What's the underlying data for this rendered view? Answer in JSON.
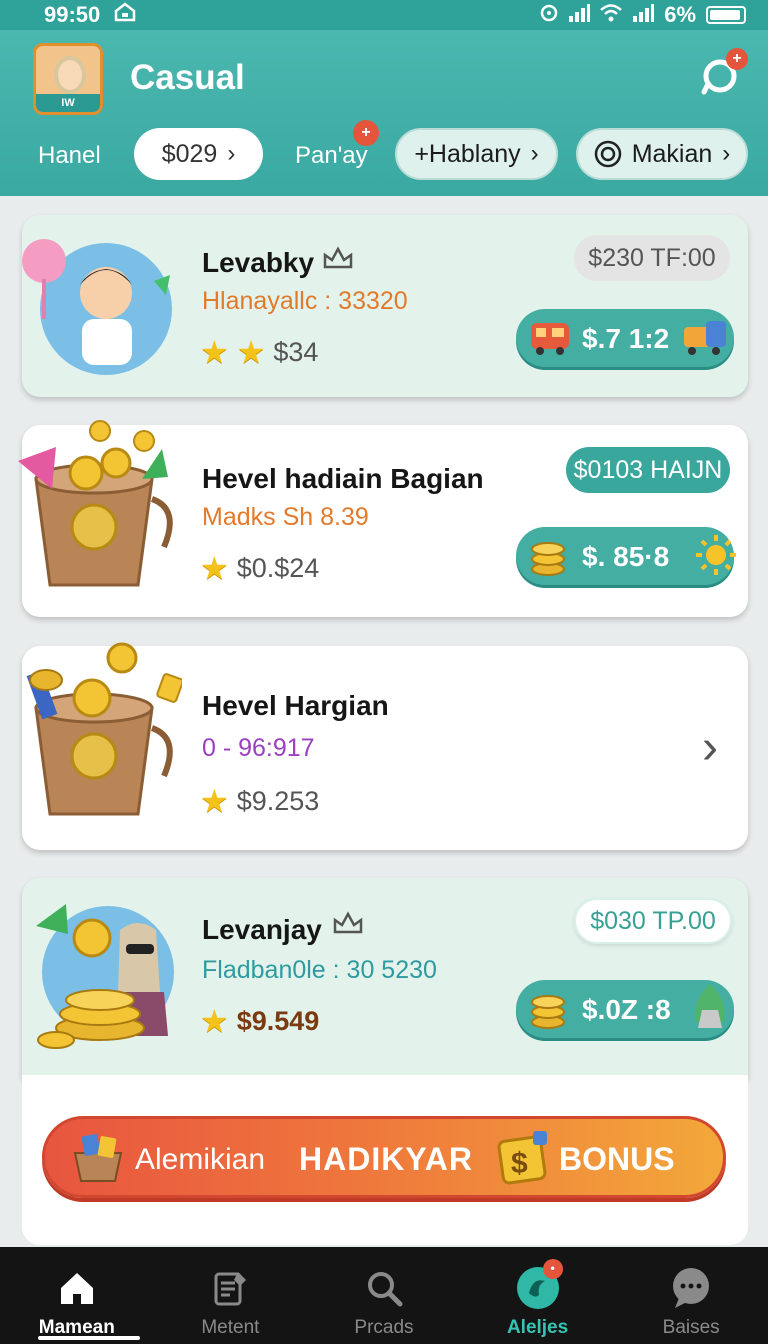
{
  "status_bar": {
    "time": "99:50",
    "battery": "6%"
  },
  "header": {
    "avatar_tag": "IW",
    "title": "Casual",
    "filters": [
      {
        "label": "Hanel"
      },
      {
        "label": "$029"
      },
      {
        "label": "Pan'ay"
      },
      {
        "label": "+Hablany"
      },
      {
        "label": "Makian"
      }
    ]
  },
  "cards": [
    {
      "title": "Levabky",
      "subtitle": "Hlanayallc : 33320",
      "rating": "$34",
      "tag": "$230 TF:00",
      "reward": "$.7 1:2"
    },
    {
      "title": "Hevel hadiain Bagian",
      "subtitle": "Madks Sh 8.39",
      "rating": "$0.$24",
      "tag": "$0103 HAIJN",
      "reward": "$. 85·8"
    },
    {
      "title": "Hevel Hargian",
      "subtitle": "0 - 96:917",
      "rating": "$9.253"
    },
    {
      "title": "Levanjay",
      "subtitle": "Fladban0le : 30 5230",
      "rating": "$9.549",
      "tag": "$030 TP.00",
      "reward": "$.0Z :8"
    }
  ],
  "bonus": {
    "text1": "Alemikian",
    "text2": "HADIKYAR",
    "text3": "BONUS"
  },
  "bottom_nav": [
    {
      "label": "Mamean"
    },
    {
      "label": "Metent"
    },
    {
      "label": "Prcads"
    },
    {
      "label": "Aleljes"
    },
    {
      "label": "Baises"
    }
  ],
  "colors": {
    "header": "#3aa9a1",
    "accent": "#44aea3",
    "bonus": "#ef7a3c"
  }
}
